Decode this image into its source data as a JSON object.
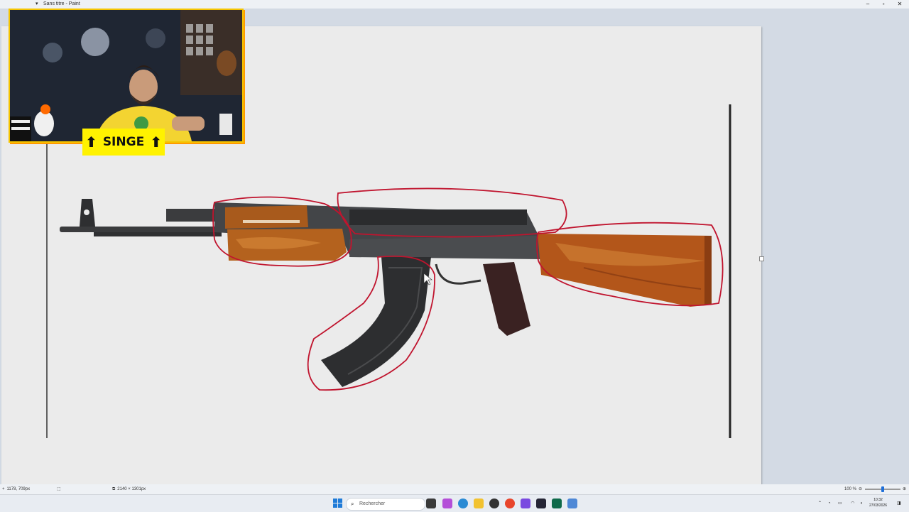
{
  "window": {
    "title": "Sans titre - Paint"
  },
  "overlay": {
    "badge_text": "SINGE"
  },
  "statusbar": {
    "cursor_position": "1178, 709px",
    "image_size": "2140 × 1301px",
    "zoom": "100 %"
  },
  "taskbar": {
    "search_placeholder": "Rechercher",
    "time": "10:32",
    "date": "27/03/2026"
  },
  "colors": {
    "annotation_red": "#c0142e",
    "badge_yellow": "#fff200",
    "webcam_border": "#f5c400",
    "canvas_bg": "#ebebeb"
  }
}
